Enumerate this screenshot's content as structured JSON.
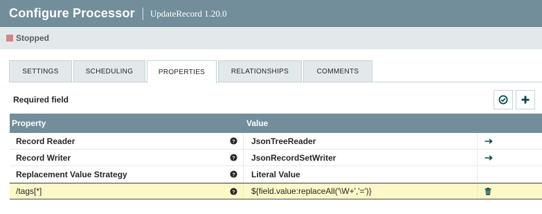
{
  "header": {
    "title": "Configure Processor",
    "subtitle": "UpdateRecord 1.20.0"
  },
  "status": {
    "label": "Stopped",
    "color": "#d18686"
  },
  "tabs": [
    {
      "label": "SETTINGS",
      "active": false
    },
    {
      "label": "SCHEDULING",
      "active": false
    },
    {
      "label": "PROPERTIES",
      "active": true
    },
    {
      "label": "RELATIONSHIPS",
      "active": false
    },
    {
      "label": "COMMENTS",
      "active": false
    }
  ],
  "properties": {
    "required_label": "Required field",
    "columns": {
      "property": "Property",
      "value": "Value"
    },
    "rows": [
      {
        "name": "Record Reader",
        "value": "JsonTreeReader",
        "action": "go-to-arrow-icon"
      },
      {
        "name": "Record Writer",
        "value": "JsonRecordSetWriter",
        "action": "go-to-arrow-icon"
      },
      {
        "name": "Replacement Value Strategy",
        "value": "Literal Value",
        "action": ""
      },
      {
        "name": "/tags[*]",
        "value": "${field.value:replaceAll('\\W+','=')}",
        "action": "trash-icon"
      }
    ]
  },
  "colors": {
    "header": "#728e9b",
    "accent": "#004849",
    "highlight": "#fcf8c7"
  }
}
